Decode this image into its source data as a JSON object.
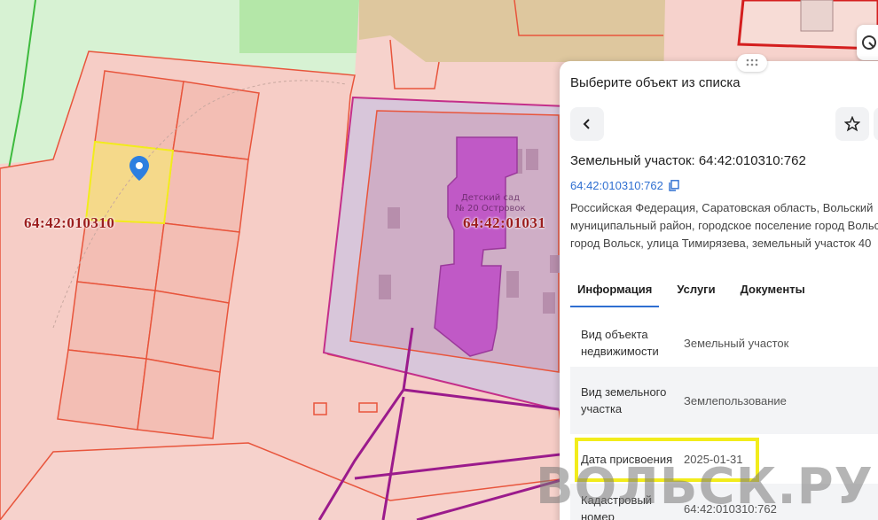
{
  "map": {
    "parcel_label_left": "64:42:010310",
    "parcel_label_center": "64:42:01031",
    "kindergarten_label": "Детский сад\n№ 20 Островок",
    "colors": {
      "background": "#f6d2cc",
      "parcel_border": "#e8553c",
      "selected_parcel_fill": "#f5d98a",
      "selected_parcel_border": "#f2ec1c",
      "building_fill": "#c059c6",
      "road_line": "#9b1b8c",
      "green_area": "#cfeecb",
      "pin": "#2d7fe0"
    },
    "icons": [
      "location-pin-icon",
      "ruler-icon"
    ]
  },
  "panel": {
    "title": "Выберите объект из списка",
    "object_title": "Земельный участок: 64:42:010310:762",
    "cadastral_link": "64:42:010310:762",
    "address": "Российская Федерация, Саратовская область, Вольский муниципальный район, городское поселение город Вольск, город Вольск, улица Тимирязева, земельный участок 40",
    "tabs": [
      {
        "label": "Информация",
        "active": true
      },
      {
        "label": "Услуги",
        "active": false
      },
      {
        "label": "Документы",
        "active": false
      }
    ],
    "rows": [
      {
        "key": "Вид объекта недвижимости",
        "value": "Земельный участок"
      },
      {
        "key": "Вид земельного участка",
        "value": "Землепользование"
      },
      {
        "key": "Дата присвоения",
        "value": "2025-01-31"
      },
      {
        "key": "Кадастровый номер",
        "value": "64:42:010310:762"
      }
    ],
    "icons": [
      "back-arrow-icon",
      "star-icon",
      "copy-icon",
      "grip-icon"
    ]
  },
  "watermark": "ВОЛЬСК.РУ"
}
